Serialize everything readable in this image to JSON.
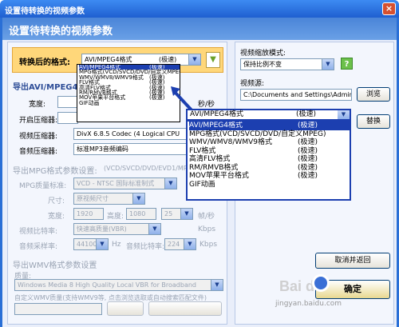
{
  "window": {
    "title": "设置待转换的视频参数",
    "close_label": "×"
  },
  "header": {
    "title": "设置待转换的视频参数"
  },
  "left": {
    "format_label": "转换后的格式:",
    "format_value": "AVI/MPEG4格式",
    "format_tag": "(极速)",
    "avi_section": "导出AVI/MPEG4格",
    "width_label": "宽度:",
    "enc_label": "开启压缩器:",
    "vcodec_label": "视频压缩器:",
    "vcodec_value": "DivX 6.8.5 Codec (4 Logical CPU",
    "acodec_label": "音频压缩器:",
    "acodec_value": "标准MP3音频编码",
    "mpg_section": "导出MPG格式参数设置:",
    "mpg_hint": "(VCD/SVCD/DVD/EVD1/MPEG1",
    "mpg_quality_label": "MPG质量标准:",
    "mpg_quality_value": "VCD - NTSC 国际标准制式",
    "size_label": "尺寸:",
    "size_value": "原视频尺寸",
    "mw_label": "宽度:",
    "mw_value": "1920",
    "mh_label": "高度:",
    "mh_value": "1080",
    "fps_value": "25",
    "fps_unit": "帧/秒",
    "vbitrate_label": "视频比特率:",
    "vbitrate_value": "快速高质量(VBR)",
    "vbitrate_unit": "Kbps",
    "arate_label": "音频采样率:",
    "arate_value": "44100",
    "arate_unit": "Hz",
    "abitrate_label": "音频比特率:",
    "abitrate_value": "224",
    "abitrate_unit": "Kbps",
    "wmv_section": "导出WMV格式参数设置",
    "wmv_quality_label": "质量:",
    "wmv_quality_value": "Windows Media 8 High Quality Local VBR for Broadband",
    "wmv_custom_label": "自定义WMV质量(支持WMV9等, 点击浏览选取或自动搜索匹配文件)",
    "sec_unit": "秒/秒"
  },
  "small_list": [
    {
      "name": "AVI/MPEG4格式",
      "tag": "(极速)"
    },
    {
      "name": "MPG格式(VCD/SVCD/DVD/自定义MPEG)",
      "tag": ""
    },
    {
      "name": "WMV/WMV8/WMV9格式",
      "tag": "(极速)"
    },
    {
      "name": "FLV格式",
      "tag": "(极速)"
    },
    {
      "name": "高清FLV格式",
      "tag": "(极速)"
    },
    {
      "name": "RM/RMVB格式",
      "tag": "(极速)"
    },
    {
      "name": "MOV苹果平台格式",
      "tag": "(极速)"
    },
    {
      "name": "GIF动画",
      "tag": ""
    }
  ],
  "big_select": {
    "name": "AVI/MPEG4格式",
    "tag": "(极速)"
  },
  "big_list": [
    {
      "name": "AVI/MPEG4格式",
      "tag": "(极速)"
    },
    {
      "name": "MPG格式(VCD/SVCD/DVD/自定义MPEG)",
      "tag": ""
    },
    {
      "name": "WMV/WMV8/WMV9格式",
      "tag": "(极速)"
    },
    {
      "name": "FLV格式",
      "tag": "(极速)"
    },
    {
      "name": "高清FLV格式",
      "tag": "(极速)"
    },
    {
      "name": "RM/RMVB格式",
      "tag": "(极速)"
    },
    {
      "name": "MOV苹果平台格式",
      "tag": "(极速)"
    },
    {
      "name": "GIF动画",
      "tag": ""
    }
  ],
  "right": {
    "scale_label": "视频缩放模式:",
    "scale_value": "保持比例不变",
    "help": "?",
    "wm_label": "视频源:",
    "wm_value": "C:\\Documents and Settings\\Admini",
    "browse": "浏览",
    "replace": "替换",
    "cancel": "取消并返回",
    "ok": "确定"
  },
  "watermark": {
    "brand": "Bai du",
    "url": "jingyan.baidu.com"
  }
}
